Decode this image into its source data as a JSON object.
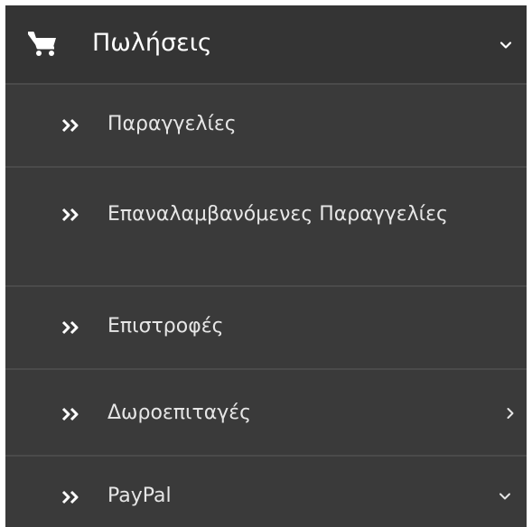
{
  "menu": {
    "header": {
      "icon": "shopping-cart-icon",
      "label": "Πωλήσεις",
      "expanded_icon": "chevron-down-icon"
    },
    "items": [
      {
        "label": "Παραγγελίες",
        "icon": "double-chevron-right-icon"
      },
      {
        "label": "Επαναλαμβανόμενες Παραγγελίες",
        "icon": "double-chevron-right-icon"
      },
      {
        "label": "Επιστροφές",
        "icon": "double-chevron-right-icon"
      },
      {
        "label": "Δωροεπιταγές",
        "icon": "double-chevron-right-icon",
        "submenu_icon": "chevron-right-icon"
      },
      {
        "label": "PayPal",
        "icon": "double-chevron-right-icon",
        "submenu_icon": "chevron-down-icon"
      }
    ]
  },
  "colors": {
    "background": "#3a3a3a",
    "header_background": "#343434",
    "divider": "#4a4a4a",
    "text": "#e6e6e6",
    "header_text": "#ffffff"
  }
}
